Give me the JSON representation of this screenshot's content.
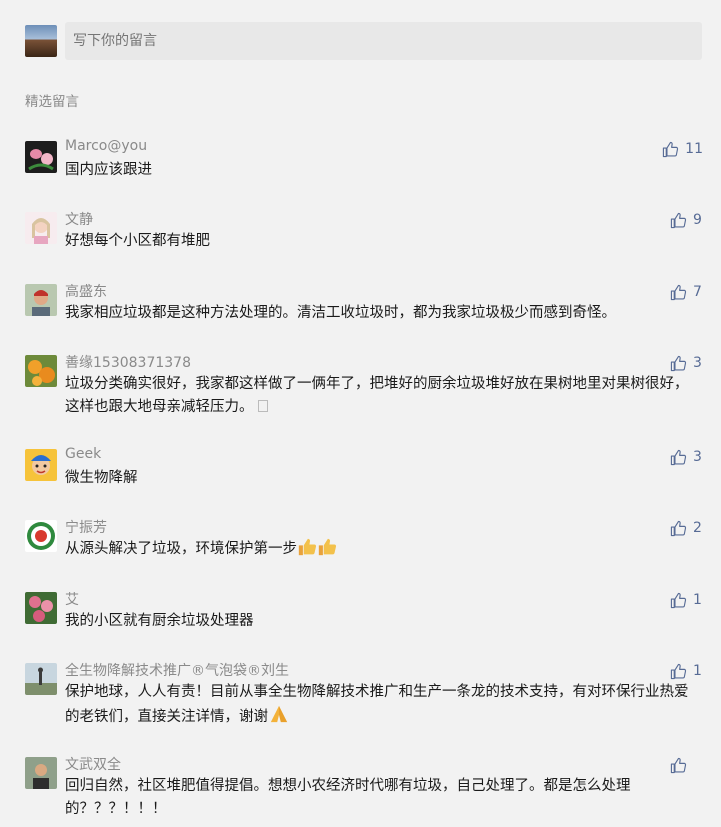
{
  "write": {
    "placeholder": "写下你的留言"
  },
  "section_title": "精选留言",
  "colors": {
    "like": "#576b95",
    "name": "#8a8a8a",
    "bg": "#f2f2f2"
  },
  "comments": [
    {
      "name": "Marco@you",
      "text": "国内应该跟进",
      "likes": "11",
      "avatar": "lotus-avatar"
    },
    {
      "name": "文静",
      "text": "好想每个小区都有堆肥",
      "likes": "9",
      "avatar": "girl-avatar"
    },
    {
      "name": "高盛东",
      "text": "我家相应垃圾都是这种方法处理的。清洁工收垃圾时，都为我家垃圾极少而感到奇怪。",
      "likes": "7",
      "avatar": "man-red-avatar"
    },
    {
      "name": "善缘15308371378",
      "text": "垃圾分类确实很好，我家都这样做了一俩年了，把堆好的厨余垃圾堆好放在果树地里对果树很好，这样也跟大地母亲减轻压力。",
      "likes": "3",
      "avatar": "fruit-avatar"
    },
    {
      "name": "Geek",
      "text": "微生物降解",
      "likes": "3",
      "avatar": "cartoon-avatar"
    },
    {
      "name": "宁振芳",
      "text": "从源头解决了垃圾，环境保护第一步",
      "likes": "2",
      "avatar": "badge-avatar"
    },
    {
      "name": "艾",
      "text": "我的小区就有厨余垃圾处理器",
      "likes": "1",
      "avatar": "flower-avatar"
    },
    {
      "name": "全生物降解技术推广®气泡袋®刘生",
      "text": "保护地球，人人有责！目前从事全生物降解技术推广和生产一条龙的技术支持，有对环保行业热爱的老铁们，直接关注详情，谢谢",
      "likes": "1",
      "avatar": "landscape-avatar"
    },
    {
      "name": "文武双全",
      "text": "回归自然，社区堆肥值得提倡。想想小农经济时代哪有垃圾，自己处理了。都是怎么处理的？？？！！！",
      "likes": "",
      "avatar": "portrait-avatar"
    }
  ]
}
